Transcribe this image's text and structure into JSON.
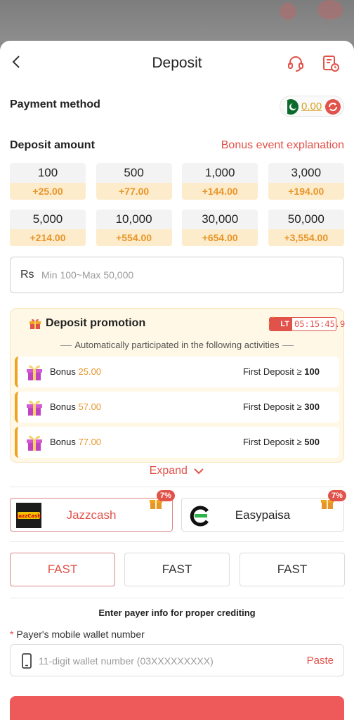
{
  "header": {
    "title": "Deposit",
    "icons": [
      "back-chevron-icon",
      "headset-icon",
      "history-icon"
    ]
  },
  "payment_method": {
    "label": "Payment method",
    "balance": "0.00",
    "flag": "pakistan-flag-icon",
    "refresh": "refresh-icon"
  },
  "deposit_amount": {
    "label": "Deposit amount",
    "bonus_link": "Bonus event explanation",
    "options": [
      {
        "amount": "100",
        "bonus": "+25.00"
      },
      {
        "amount": "500",
        "bonus": "+77.00"
      },
      {
        "amount": "1,000",
        "bonus": "+144.00"
      },
      {
        "amount": "3,000",
        "bonus": "+194.00"
      },
      {
        "amount": "5,000",
        "bonus": "+214.00"
      },
      {
        "amount": "10,000",
        "bonus": "+554.00"
      },
      {
        "amount": "30,000",
        "bonus": "+654.00"
      },
      {
        "amount": "50,000",
        "bonus": "+3,554.00"
      }
    ],
    "currency": "Rs",
    "placeholder": "Min 100~Max 50,000"
  },
  "promotion": {
    "title": "Deposit promotion",
    "lt_tag": "LT",
    "timer": "05:15:45.9",
    "subtitle": "Automatically participated in the following activities",
    "items": [
      {
        "bonus_label": "Bonus",
        "bonus_value": "25.00",
        "condition": "First Deposit ≥",
        "threshold": "100"
      },
      {
        "bonus_label": "Bonus",
        "bonus_value": "57.00",
        "condition": "First Deposit ≥",
        "threshold": "300"
      },
      {
        "bonus_label": "Bonus",
        "bonus_value": "77.00",
        "condition": "First Deposit ≥",
        "threshold": "500"
      }
    ],
    "expand_label": "Expand"
  },
  "channels": [
    {
      "name": "Jazzcash",
      "badge": "7%",
      "selected": true,
      "logo_text": "JazzCash"
    },
    {
      "name": "Easypaisa",
      "badge": "7%",
      "selected": false
    }
  ],
  "speed_options": [
    {
      "label": "FAST",
      "selected": true
    },
    {
      "label": "FAST",
      "selected": false
    },
    {
      "label": "FAST",
      "selected": false
    }
  ],
  "payer_info": {
    "hint": "Enter payer info for proper crediting",
    "required_mark": "*",
    "wallet_label": "Payer's mobile wallet number",
    "wallet_placeholder": "11-digit wallet number (03XXXXXXXXX)",
    "paste_label": "Paste"
  },
  "colors": {
    "accent": "#e1524a",
    "bonus": "#e7952a",
    "highlight_bg": "#fdeccb",
    "promo_bg": "#fff8e6"
  }
}
